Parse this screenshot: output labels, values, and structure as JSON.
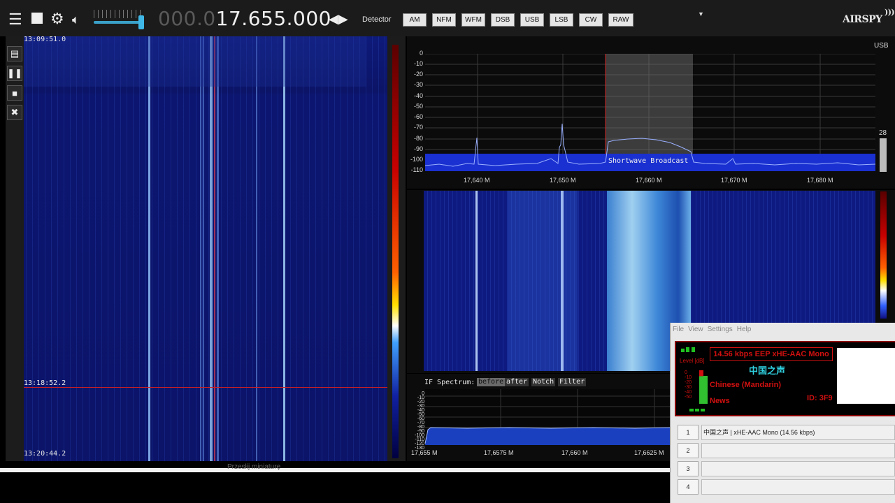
{
  "toolbar": {
    "menu_icon": "hamburger-icon",
    "stop_icon": "stop-icon",
    "settings_icon": "gear-icon",
    "volume_icon": "speaker-icon",
    "freq_dim": "000.0",
    "freq_bright": "17.655.000",
    "detector_label": "Detector",
    "modes": [
      "AM",
      "NFM",
      "WFM",
      "DSB",
      "USB",
      "LSB",
      "CW",
      "RAW"
    ],
    "logo": "AIRSPY"
  },
  "left_waterfall": {
    "times": [
      "13:09:51.0",
      "13:18:52.2",
      "13:20:44.2"
    ],
    "tools": [
      "document-icon",
      "pause-icon",
      "stop-icon",
      "tools-icon"
    ]
  },
  "spectrum": {
    "mode_label": "USB",
    "level_value": "28",
    "y_ticks": [
      "0",
      "-10",
      "-20",
      "-30",
      "-40",
      "-50",
      "-60",
      "-70",
      "-80",
      "-90",
      "-100",
      "-110"
    ],
    "x_ticks": [
      "17,640 M",
      "17,650 M",
      "17,660 M",
      "17,670 M",
      "17,680 M"
    ],
    "band_label": "Shortwave Broadcast"
  },
  "if_spectrum": {
    "title": "IF Spectrum:",
    "buttons": [
      "before",
      "after",
      "Notch",
      "Filter"
    ],
    "y_ticks": [
      "0",
      "-10",
      "-20",
      "-30",
      "-40",
      "-50",
      "-60",
      "-70",
      "-80",
      "-90",
      "-100",
      "-110",
      "-120",
      "-130"
    ],
    "x_ticks": [
      "17,655 M",
      "17,6575 M",
      "17,660 M",
      "17,6625 M"
    ]
  },
  "bottom_strip": {
    "label": "Przesłij miniaturę"
  },
  "drm": {
    "menu": [
      "File",
      "View",
      "Settings",
      "Help"
    ],
    "level_label": "Level [dB]",
    "scale": [
      "0",
      "-10",
      "-20",
      "-30",
      "-40",
      "-50"
    ],
    "rate": "14.56 kbps EEP xHE-AAC Mono",
    "station": "中国之声",
    "language": "Chinese (Mandarin)",
    "program_type": "News",
    "id": "ID: 3F9",
    "services": [
      {
        "num": "1",
        "label": "中国之声  |   xHE-AAC Mono (14.56 kbps)"
      },
      {
        "num": "2",
        "label": ""
      },
      {
        "num": "3",
        "label": ""
      },
      {
        "num": "4",
        "label": ""
      }
    ]
  }
}
